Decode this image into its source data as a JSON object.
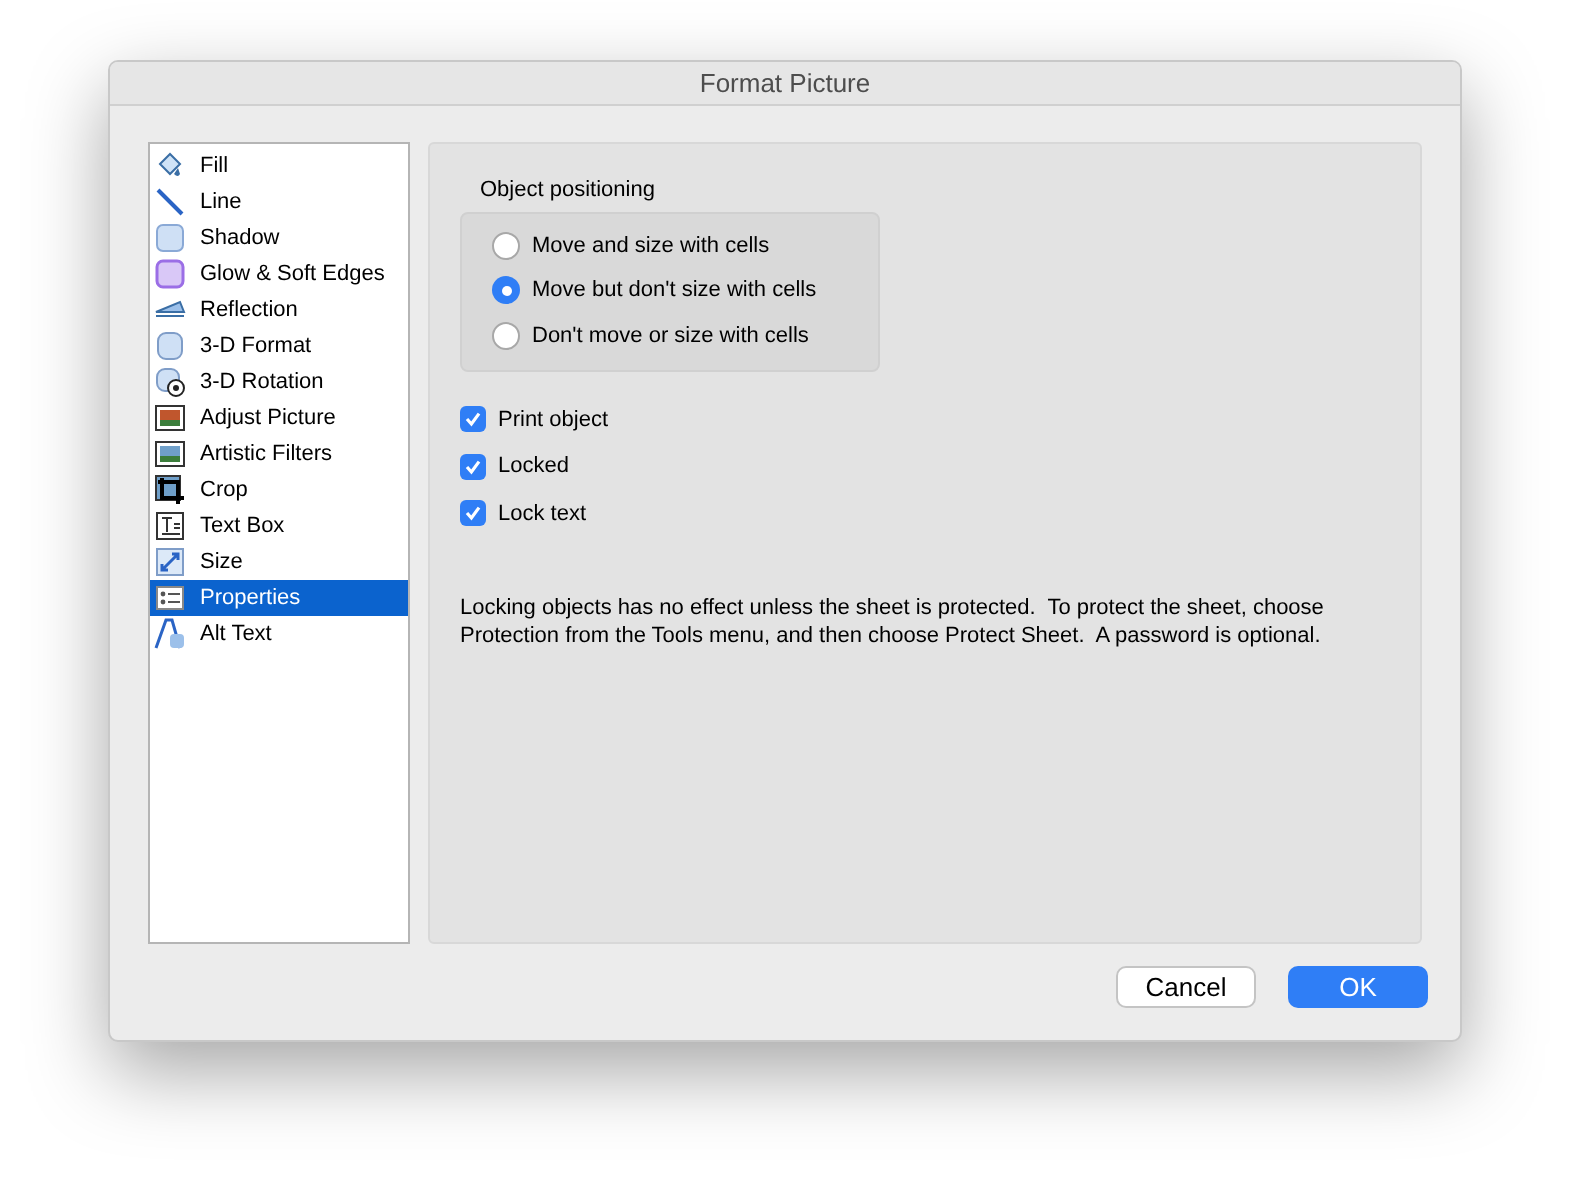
{
  "window": {
    "title": "Format Picture"
  },
  "sidebar": {
    "items": [
      {
        "label": "Fill",
        "selected": false
      },
      {
        "label": "Line",
        "selected": false
      },
      {
        "label": "Shadow",
        "selected": false
      },
      {
        "label": "Glow & Soft Edges",
        "selected": false
      },
      {
        "label": "Reflection",
        "selected": false
      },
      {
        "label": "3-D Format",
        "selected": false
      },
      {
        "label": "3-D Rotation",
        "selected": false
      },
      {
        "label": "Adjust Picture",
        "selected": false
      },
      {
        "label": "Artistic Filters",
        "selected": false
      },
      {
        "label": "Crop",
        "selected": false
      },
      {
        "label": "Text Box",
        "selected": false
      },
      {
        "label": "Size",
        "selected": false
      },
      {
        "label": "Properties",
        "selected": true
      },
      {
        "label": "Alt Text",
        "selected": false
      }
    ]
  },
  "object_positioning": {
    "title": "Object positioning",
    "options": [
      {
        "label": "Move and size with cells",
        "selected": false
      },
      {
        "label": "Move but don't size with cells",
        "selected": true
      },
      {
        "label": "Don't move or size with cells",
        "selected": false
      }
    ]
  },
  "checkboxes": [
    {
      "label": "Print object",
      "checked": true
    },
    {
      "label": "Locked",
      "checked": true
    },
    {
      "label": "Lock text",
      "checked": true
    }
  ],
  "note": "Locking objects has no effect unless the sheet is protected.  To protect the sheet, choose Protection from the Tools menu, and then choose Protect Sheet.  A password is optional.",
  "buttons": [
    {
      "label": "Cancel",
      "kind": "secondary"
    },
    {
      "label": "OK",
      "kind": "primary"
    }
  ]
}
